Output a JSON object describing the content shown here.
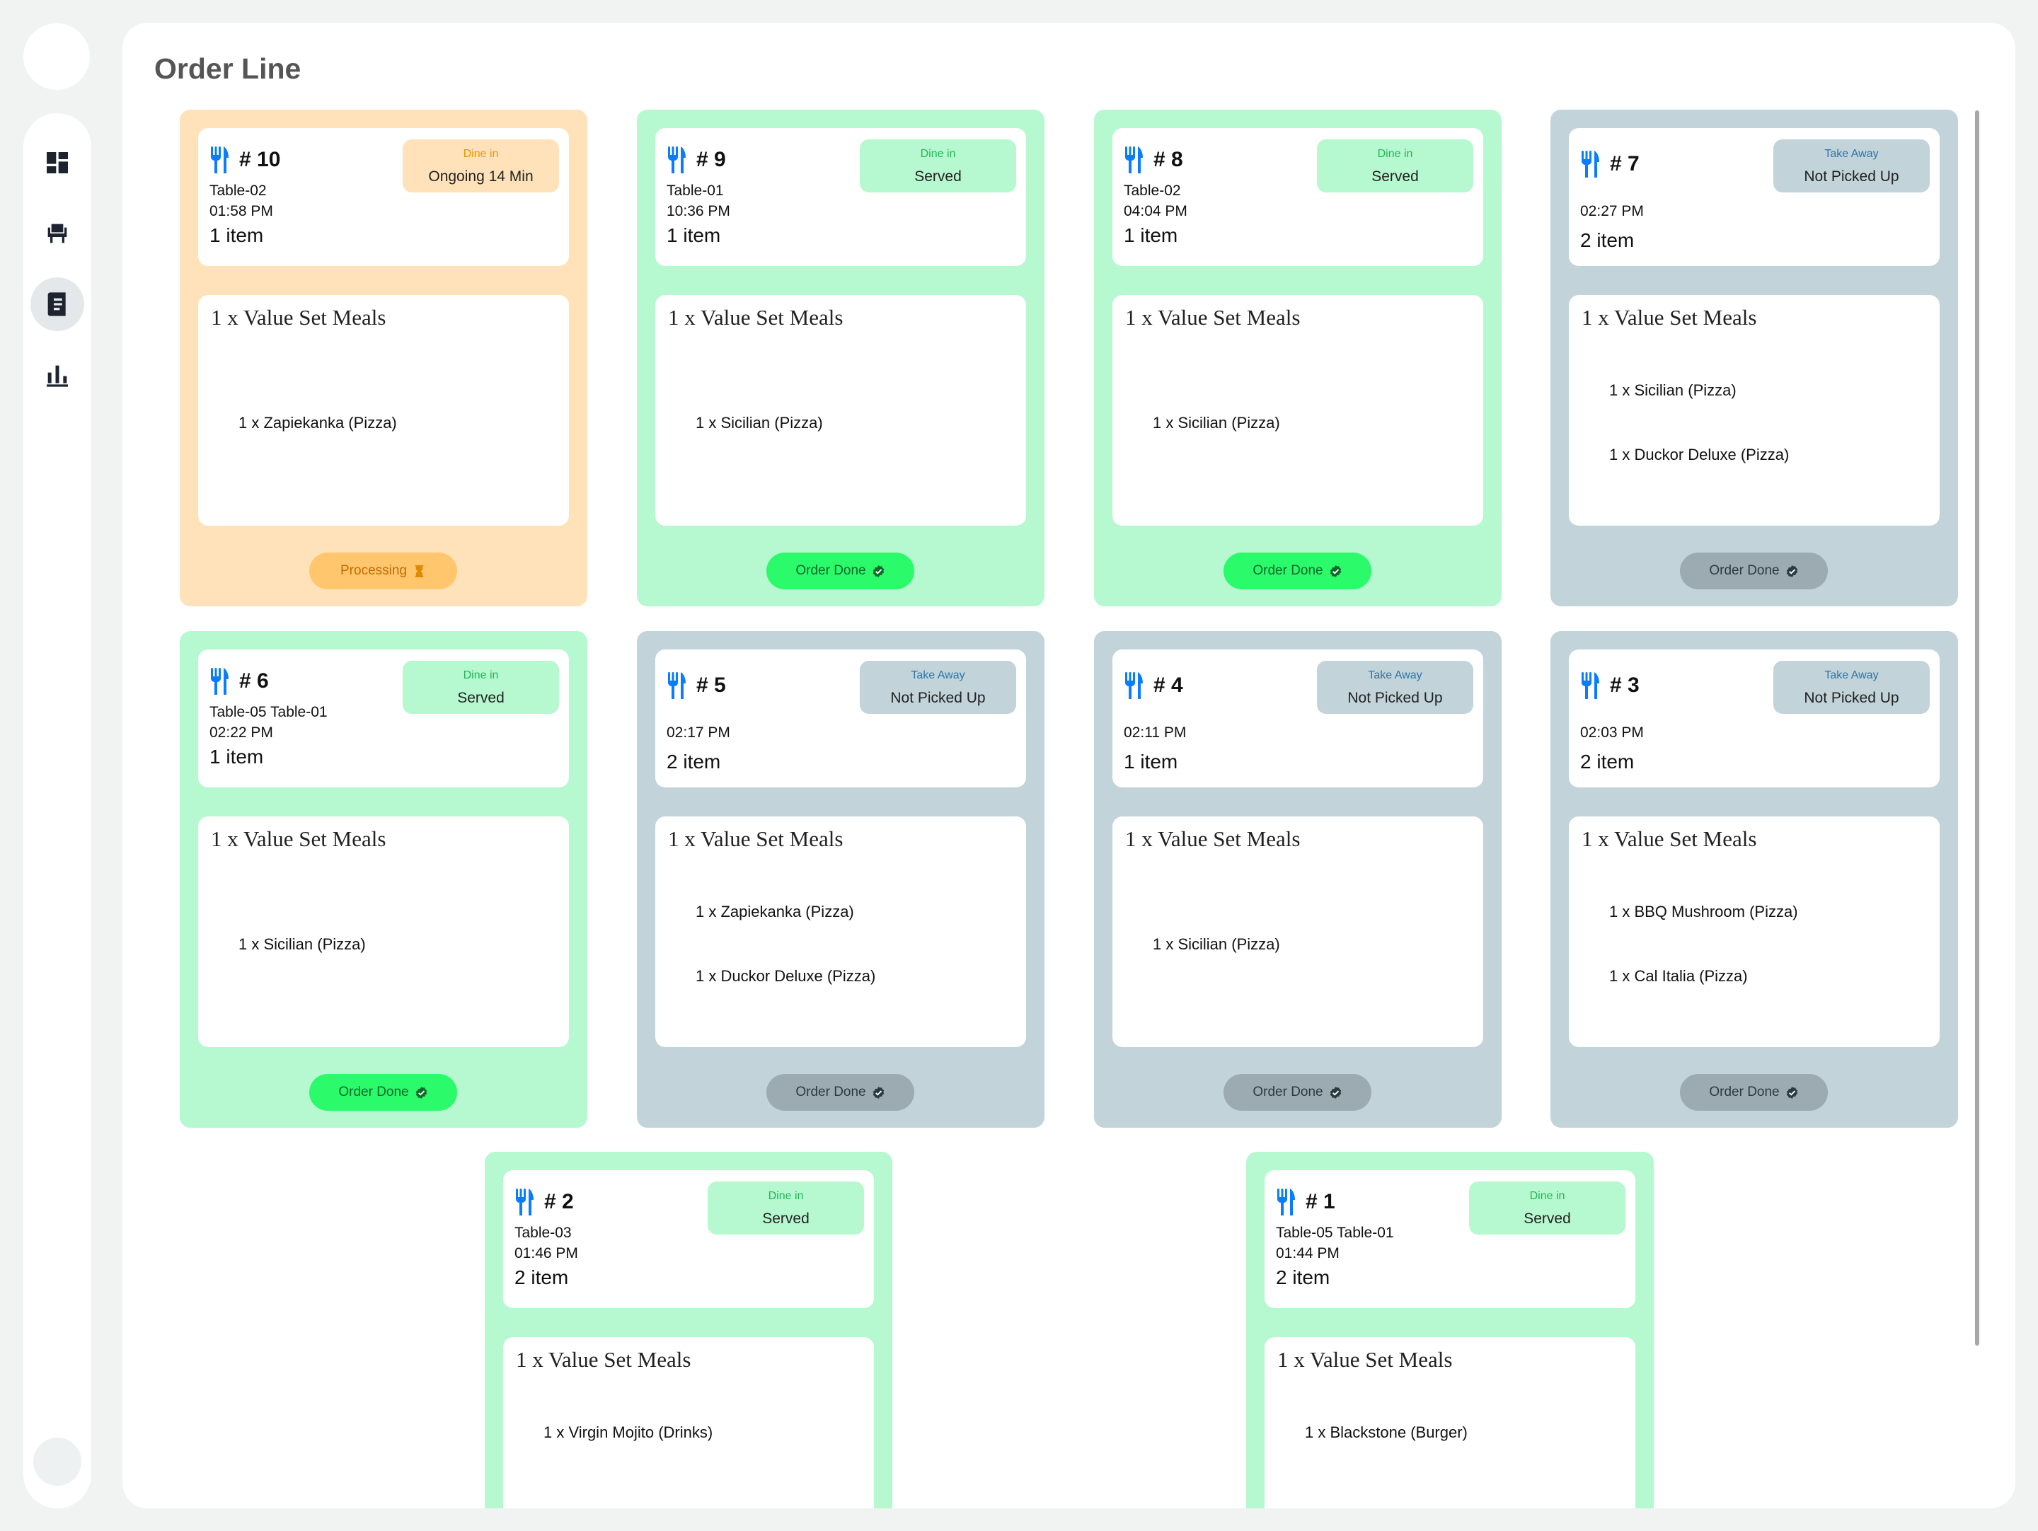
{
  "page": {
    "title": "Order Line"
  },
  "nav": [
    {
      "name": "dashboard",
      "icon": "dashboard-icon",
      "active": false
    },
    {
      "name": "tables",
      "icon": "table-chair-icon",
      "active": false
    },
    {
      "name": "orders",
      "icon": "receipt-icon",
      "active": true
    },
    {
      "name": "reports",
      "icon": "bar-chart-icon",
      "active": false
    }
  ],
  "orders": [
    {
      "num": "# 10",
      "theme": "orange",
      "type": "Dine in",
      "status": "Ongoing 14 Min",
      "table": "Table-02",
      "time": "01:58 PM",
      "count": "1 item",
      "meal": "1 x Value Set Meals",
      "items": [
        "1 x Zapiekanka (Pizza)"
      ],
      "action": "Processing",
      "action_icon": "hourglass-icon"
    },
    {
      "num": "# 9",
      "theme": "green",
      "type": "Dine in",
      "status": "Served",
      "table": "Table-01",
      "time": "10:36 PM",
      "count": "1 item",
      "meal": "1 x Value Set Meals",
      "items": [
        "1 x Sicilian (Pizza)"
      ],
      "action": "Order Done",
      "action_icon": "check-badge-icon"
    },
    {
      "num": "# 8",
      "theme": "green",
      "type": "Dine in",
      "status": "Served",
      "table": "Table-02",
      "time": "04:04 PM",
      "count": "1 item",
      "meal": "1 x Value Set Meals",
      "items": [
        "1 x Sicilian (Pizza)"
      ],
      "action": "Order Done",
      "action_icon": "check-badge-icon"
    },
    {
      "num": "# 7",
      "theme": "gray",
      "type": "Take Away",
      "status": "Not Picked Up",
      "table": "",
      "time": "02:27 PM",
      "count": "2 item",
      "meal": "1 x Value Set Meals",
      "items": [
        "1 x Sicilian (Pizza)",
        "1 x Duckor Deluxe (Pizza)"
      ],
      "action": "Order Done",
      "action_icon": "check-badge-icon"
    },
    {
      "num": "# 6",
      "theme": "green",
      "type": "Dine in",
      "status": "Served",
      "table": "Table-05 Table-01",
      "time": "02:22 PM",
      "count": "1 item",
      "meal": "1 x Value Set Meals",
      "items": [
        "1 x Sicilian (Pizza)"
      ],
      "action": "Order Done",
      "action_icon": "check-badge-icon"
    },
    {
      "num": "# 5",
      "theme": "gray",
      "type": "Take Away",
      "status": "Not Picked Up",
      "table": "",
      "time": "02:17 PM",
      "count": "2 item",
      "meal": "1 x Value Set Meals",
      "items": [
        "1 x Zapiekanka (Pizza)",
        "1 x Duckor Deluxe (Pizza)"
      ],
      "action": "Order Done",
      "action_icon": "check-badge-icon"
    },
    {
      "num": "# 4",
      "theme": "gray",
      "type": "Take Away",
      "status": "Not Picked Up",
      "table": "",
      "time": "02:11 PM",
      "count": "1 item",
      "meal": "1 x Value Set Meals",
      "items": [
        "1 x Sicilian (Pizza)"
      ],
      "action": "Order Done",
      "action_icon": "check-badge-icon"
    },
    {
      "num": "# 3",
      "theme": "gray",
      "type": "Take Away",
      "status": "Not Picked Up",
      "table": "",
      "time": "02:03 PM",
      "count": "2 item",
      "meal": "1 x Value Set Meals",
      "items": [
        "1 x BBQ Mushroom (Pizza)",
        "1 x Cal Italia (Pizza)"
      ],
      "action": "Order Done",
      "action_icon": "check-badge-icon"
    },
    {
      "num": "# 2",
      "theme": "green",
      "type": "Dine in",
      "status": "Served",
      "table": "Table-03",
      "time": "01:46 PM",
      "count": "2 item",
      "meal": "1 x Value Set Meals",
      "items": [
        "1 x Virgin Mojito (Drinks)"
      ],
      "action": "",
      "action_icon": ""
    },
    {
      "num": "# 1",
      "theme": "green",
      "type": "Dine in",
      "status": "Served",
      "table": "Table-05 Table-01",
      "time": "01:44 PM",
      "count": "2 item",
      "meal": "1 x Value Set Meals",
      "items": [
        "1 x Blackstone (Burger)"
      ],
      "action": "",
      "action_icon": ""
    }
  ],
  "colors": {
    "orange": "#ffe2b9",
    "green": "#b6f8cf",
    "gray": "#c2d3da",
    "icon_blue": "#0a7cff"
  }
}
